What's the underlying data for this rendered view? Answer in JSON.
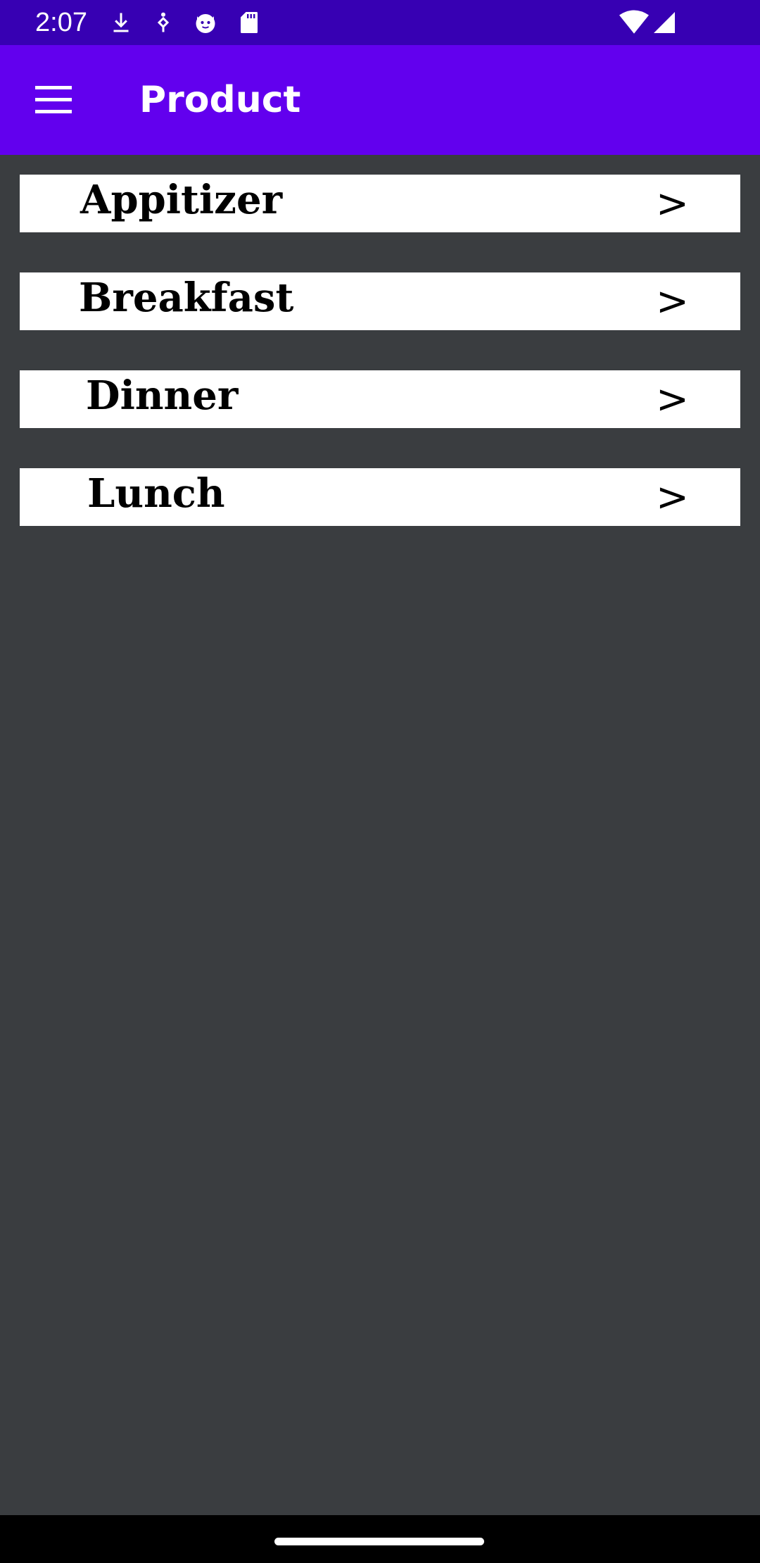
{
  "status_bar": {
    "time": "2:07",
    "left_icons": [
      "download-icon",
      "accessibility-icon",
      "cat-icon",
      "sd-card-icon"
    ],
    "right_icons": [
      "wifi-icon",
      "cell-signal-icon"
    ]
  },
  "app_bar": {
    "title": "Product",
    "menu_icon": "hamburger-menu-icon",
    "color": "#6200ee"
  },
  "categories": [
    {
      "label": "Appitizer",
      "arrow": ">"
    },
    {
      "label": "Breakfast",
      "arrow": ">"
    },
    {
      "label": "Dinner",
      "arrow": ">"
    },
    {
      "label": "Lunch",
      "arrow": ">"
    }
  ],
  "colors": {
    "status_bar": "#3700b3",
    "background": "#3a3d40",
    "item_background": "#ffffff"
  }
}
